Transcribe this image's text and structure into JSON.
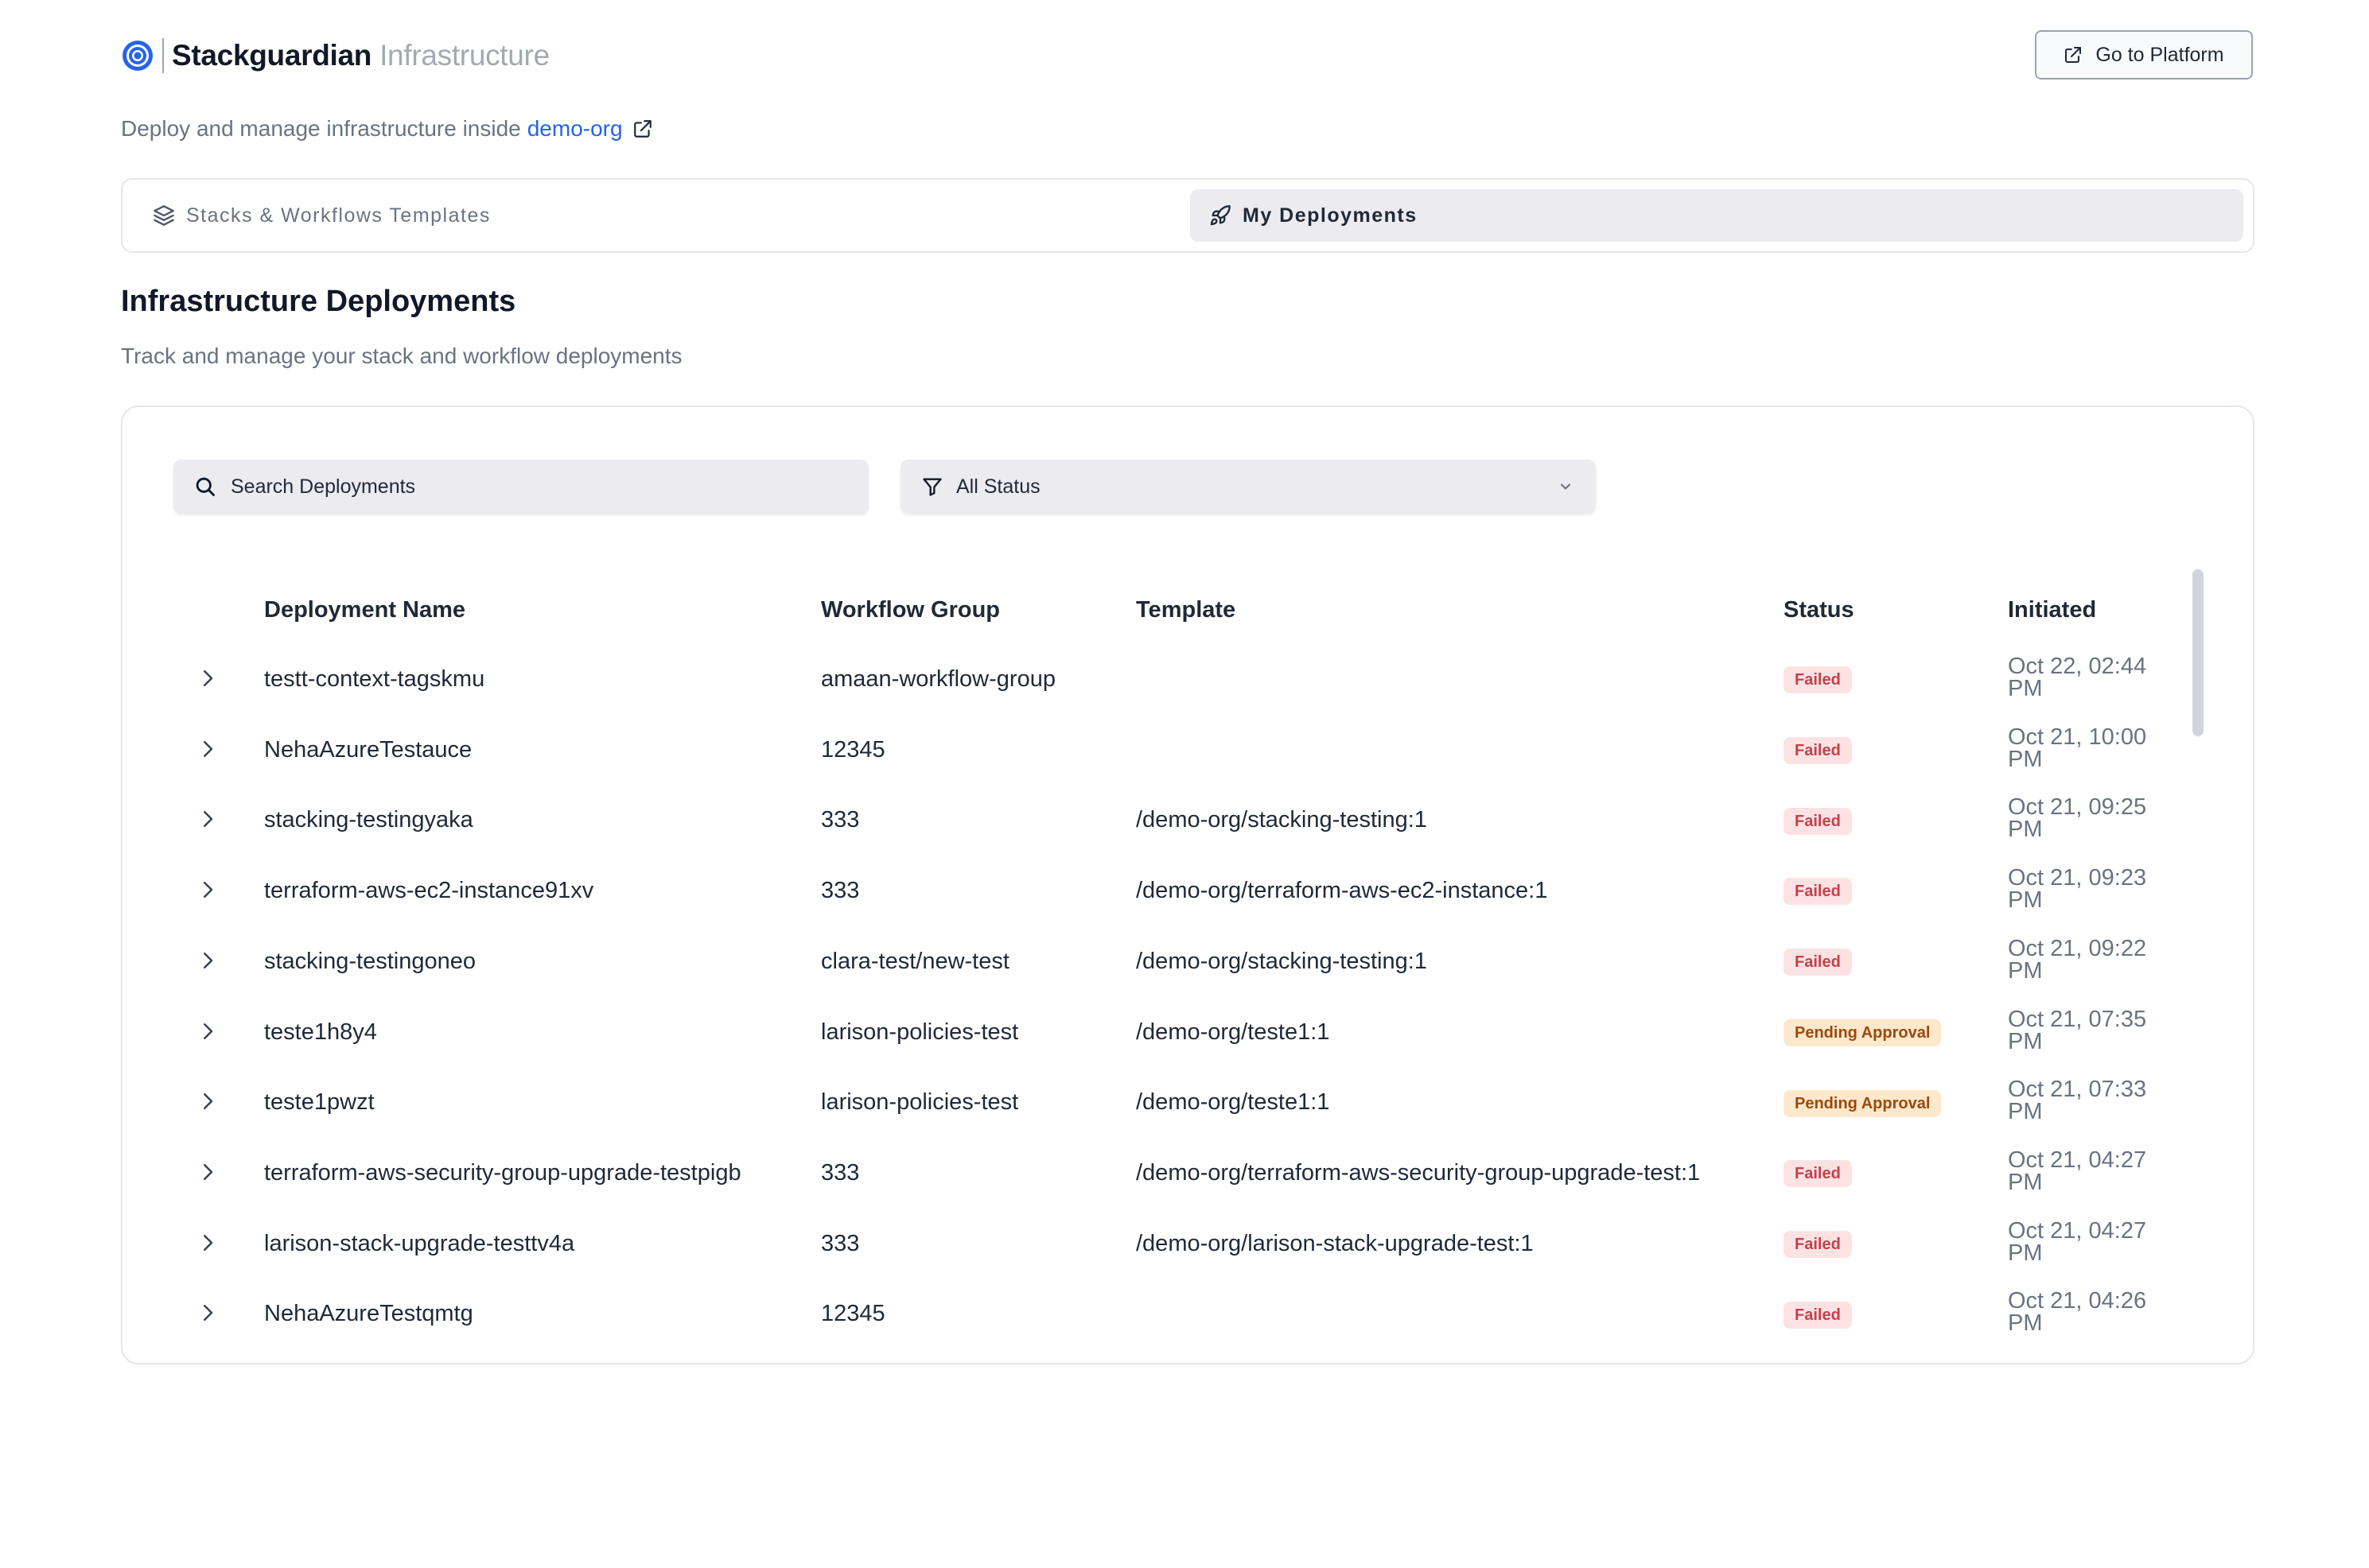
{
  "brand": {
    "name": "Stackguardian",
    "product": "Infrastructure"
  },
  "header": {
    "go_to_platform": "Go to Platform"
  },
  "subtitle": {
    "text": "Deploy and manage infrastructure inside",
    "org": "demo-org"
  },
  "tabs": [
    {
      "label": "Stacks & Workflows Templates",
      "icon": "layers-icon",
      "active": false
    },
    {
      "label": "My Deployments",
      "icon": "rocket-icon",
      "active": true
    }
  ],
  "section": {
    "title": "Infrastructure Deployments",
    "subtitle": "Track and manage your stack and workflow deployments"
  },
  "search": {
    "placeholder": "Search Deployments",
    "value": ""
  },
  "status_filter": {
    "value": "All Status"
  },
  "table": {
    "columns": {
      "name": "Deployment Name",
      "group": "Workflow Group",
      "template": "Template",
      "status": "Status",
      "initiated": "Initiated"
    },
    "rows": [
      {
        "name": "testt-context-tagskmu",
        "group": "amaan-workflow-group",
        "template": "",
        "status": "Failed",
        "initiated": "Oct 22, 02:44 PM"
      },
      {
        "name": "NehaAzureTestauce",
        "group": "12345",
        "template": "",
        "status": "Failed",
        "initiated": "Oct 21, 10:00 PM"
      },
      {
        "name": "stacking-testingyaka",
        "group": "333",
        "template": "/demo-org/stacking-testing:1",
        "status": "Failed",
        "initiated": "Oct 21, 09:25 PM"
      },
      {
        "name": "terraform-aws-ec2-instance91xv",
        "group": "333",
        "template": "/demo-org/terraform-aws-ec2-instance:1",
        "status": "Failed",
        "initiated": "Oct 21, 09:23 PM"
      },
      {
        "name": "stacking-testingoneo",
        "group": "clara-test/new-test",
        "template": "/demo-org/stacking-testing:1",
        "status": "Failed",
        "initiated": "Oct 21, 09:22 PM"
      },
      {
        "name": "teste1h8y4",
        "group": "larison-policies-test",
        "template": "/demo-org/teste1:1",
        "status": "Pending Approval",
        "initiated": "Oct 21, 07:35 PM"
      },
      {
        "name": "teste1pwzt",
        "group": "larison-policies-test",
        "template": "/demo-org/teste1:1",
        "status": "Pending Approval",
        "initiated": "Oct 21, 07:33 PM"
      },
      {
        "name": "terraform-aws-security-group-upgrade-testpigb",
        "group": "333",
        "template": "/demo-org/terraform-aws-security-group-upgrade-test:1",
        "status": "Failed",
        "initiated": "Oct 21, 04:27 PM"
      },
      {
        "name": "larison-stack-upgrade-testtv4a",
        "group": "333",
        "template": "/demo-org/larison-stack-upgrade-test:1",
        "status": "Failed",
        "initiated": "Oct 21, 04:27 PM"
      },
      {
        "name": "NehaAzureTestqmtg",
        "group": "12345",
        "template": "",
        "status": "Failed",
        "initiated": "Oct 21, 04:26 PM"
      }
    ]
  },
  "colors": {
    "accent": "#2563eb",
    "failed_bg": "#fde2e4",
    "failed_fg": "#c2414b",
    "pending_bg": "#fde8cc",
    "pending_fg": "#9a4a0c"
  }
}
